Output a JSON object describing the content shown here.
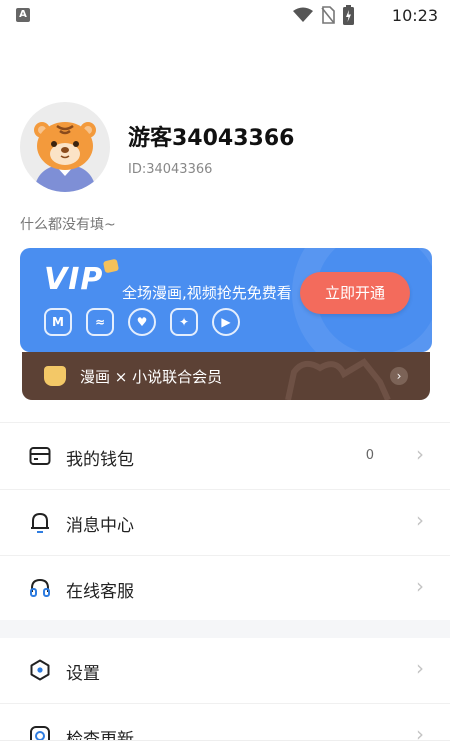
{
  "status_bar": {
    "time": "10:23",
    "app_badge": "A",
    "icons": [
      "wifi-icon",
      "no-sim-icon",
      "battery-charging-icon"
    ]
  },
  "profile": {
    "username": "游客34043366",
    "user_id": "ID:34043366",
    "bio": "什么都没有填~",
    "avatar_icon": "tiger-avatar-icon"
  },
  "vip": {
    "logo": "VIP",
    "description": "全场漫画,视频抢先免费看",
    "cta": "立即开通",
    "perks": [
      {
        "icon": "manga-perk-icon",
        "glyph": "M"
      },
      {
        "icon": "chat-perk-icon",
        "glyph": "≈"
      },
      {
        "icon": "heart-perk-icon",
        "glyph": "♥"
      },
      {
        "icon": "gift-perk-icon",
        "glyph": "✦"
      },
      {
        "icon": "play-perk-icon",
        "glyph": "▶"
      }
    ],
    "union_text": "漫画 × 小说联合会员",
    "colors": {
      "card": "#4a8ef0",
      "button": "#f36b5c",
      "union_bar": "#5c4135"
    }
  },
  "menu": {
    "items": [
      {
        "label": "我的钱包",
        "count": "0",
        "icon": "wallet-icon"
      },
      {
        "label": "消息中心",
        "count": "",
        "icon": "bell-icon"
      },
      {
        "label": "在线客服",
        "count": "",
        "icon": "headset-icon"
      },
      {
        "label": "设置",
        "count": "",
        "icon": "settings-hexagon-icon"
      },
      {
        "label": "检查更新",
        "count": "",
        "icon": "update-icon"
      }
    ]
  }
}
